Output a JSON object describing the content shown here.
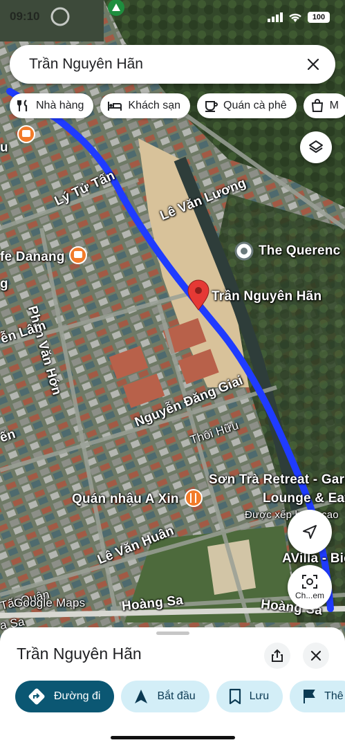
{
  "status": {
    "time": "09:10",
    "battery": "100"
  },
  "search": {
    "query": "Trần Nguyên Hãn"
  },
  "chips": [
    {
      "label": "Nhà hàng",
      "icon": "fork-knife-icon"
    },
    {
      "label": "Khách sạn",
      "icon": "bed-icon"
    },
    {
      "label": "Quán cà phê",
      "icon": "coffee-cup-icon"
    },
    {
      "label": "M",
      "icon": "shopping-bag-icon"
    }
  ],
  "map": {
    "attribution": "Google Maps",
    "pin_label": "Trần Nguyên Hãn",
    "route_color": "#1f3bff",
    "streets": {
      "ly_tu_tan": "Lý Tử Tấn",
      "le_van_luong": "Lê Văn Lương",
      "phan_van_hon": "Phan Văn Hớn",
      "nguyen_dang_giai": "Nguyễn Đăng Giai",
      "thoi_huu": "Thôi Hữu",
      "le_van_huan": "Lê Văn Huân",
      "hoang_sa": "Hoàng Sa",
      "hoang_sa_right": "Hoàng Sa",
      "van_lam": "ễn Lâm",
      "left_en": "ến",
      "left_g": "g",
      "left_u": "u",
      "tat_quan": "Tất Quân",
      "left_sa": "a Sa"
    },
    "pois": {
      "quercus": "The Querenc",
      "cafe_danang": "fe Danang",
      "son_tra": "Sơn Trà Retreat - Gard",
      "lounge": "Lounge & Eat",
      "rated": "Được xếp hạng cao",
      "quan_nhau": "Quán nhậu A Xin",
      "avilla": "AVilla - Bie"
    },
    "chip_btn_label": "Ch...em"
  },
  "sheet": {
    "title": "Trần Nguyên Hãn",
    "actions": [
      {
        "label": "Đường đi",
        "icon": "directions-icon"
      },
      {
        "label": "Bắt đầu",
        "icon": "navigation-arrow-icon"
      },
      {
        "label": "Lưu",
        "icon": "bookmark-icon"
      },
      {
        "label": "Thê",
        "icon": "flag-icon"
      }
    ]
  }
}
